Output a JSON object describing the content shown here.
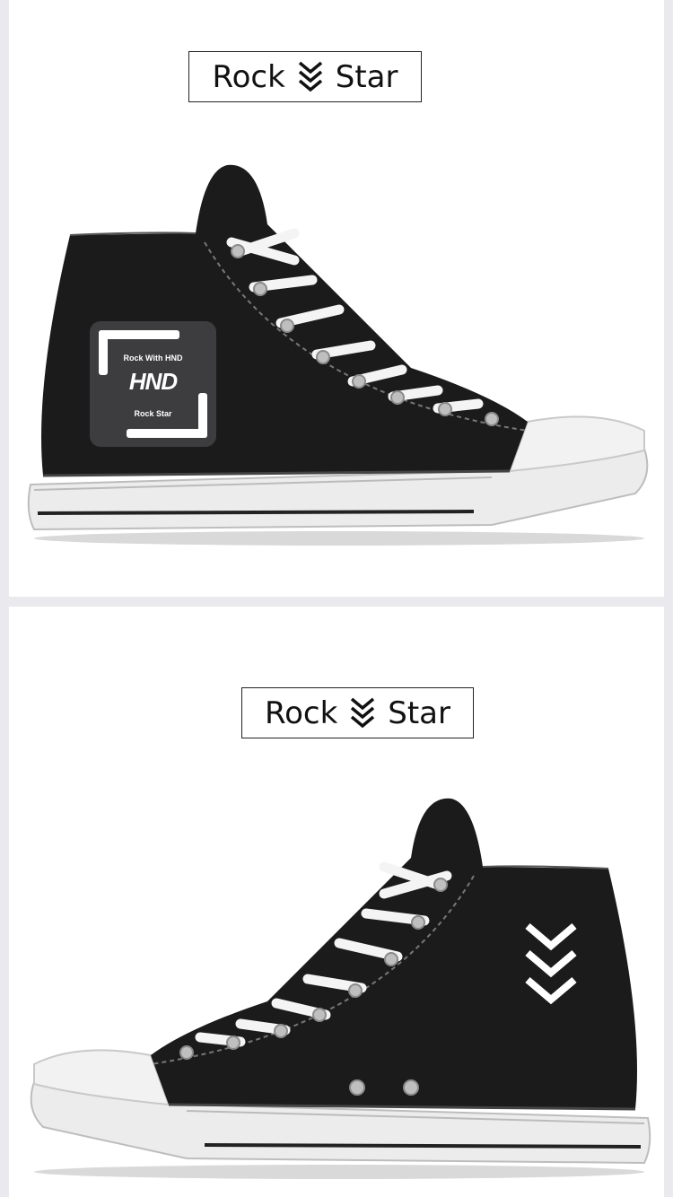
{
  "cards": [
    {
      "brand": {
        "left_word": "Rock",
        "right_word": "Star",
        "icon": "triple-chevron-down-icon"
      },
      "product": {
        "type": "high-top sneaker",
        "facing": "right",
        "color": "#1b1b1b"
      },
      "patch": {
        "top_text": "Rock With HND",
        "logo_text": "HND",
        "bottom_text": "Rock Star"
      }
    },
    {
      "brand": {
        "left_word": "Rock",
        "right_word": "Star",
        "icon": "triple-chevron-down-icon"
      },
      "product": {
        "type": "high-top sneaker",
        "facing": "left",
        "color": "#1b1b1b"
      },
      "emblem": {
        "icon": "triple-chevron-down-icon",
        "color": "#ffffff"
      }
    }
  ]
}
